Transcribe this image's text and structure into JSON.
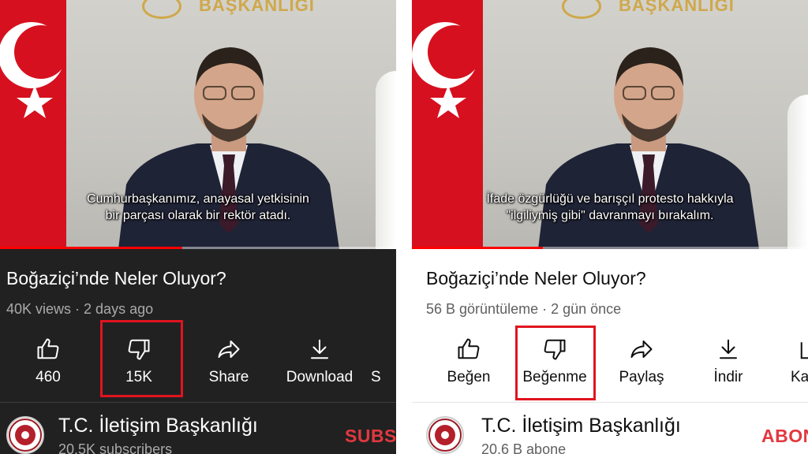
{
  "accent": "#e0141e",
  "left": {
    "theme": "dark",
    "video": {
      "subtitle_line1": "Cumhurbaşkanımız, anayasal yetkisinin",
      "subtitle_line2": "bir parçası olarak bir rektör atadı.",
      "progress": 0.46
    },
    "title": "Boğaziçi’nde Neler Oluyor?",
    "meta": "40K views · 2 days ago",
    "actions": {
      "like": {
        "label": "460",
        "icon": "thumbs-up-icon"
      },
      "dislike": {
        "label": "15K",
        "icon": "thumbs-down-icon"
      },
      "share": {
        "label": "Share",
        "icon": "share-icon"
      },
      "download": {
        "label": "Download",
        "icon": "download-icon"
      },
      "more": {
        "label": "S"
      }
    },
    "channel": {
      "name": "T.C. İletişim Başkanlığı",
      "subscribers": "20.5K subscribers",
      "subscribe_label": "SUBS"
    }
  },
  "right": {
    "theme": "light",
    "video": {
      "subtitle_line1": "İfade özgürlüğü ve barışçıl protesto hakkıyla",
      "subtitle_line2": "\"ilgiliymiş gibi\" davranmayı bırakalım.",
      "progress": 0.33
    },
    "title": "Boğaziçi’nde Neler Oluyor?",
    "meta": "56 B görüntüleme · 2 gün önce",
    "actions": {
      "like": {
        "label": "Beğen",
        "icon": "thumbs-up-icon"
      },
      "dislike": {
        "label": "Beğenme",
        "icon": "thumbs-down-icon"
      },
      "share": {
        "label": "Paylaş",
        "icon": "share-icon"
      },
      "download": {
        "label": "İndir",
        "icon": "download-icon"
      },
      "more": {
        "label": "Ka",
        "icon": "library-icon"
      }
    },
    "channel": {
      "name": "T.C. İletişim Başkanlığı",
      "subscribers": "20,6 B abone",
      "subscribe_label": "ABON"
    }
  }
}
